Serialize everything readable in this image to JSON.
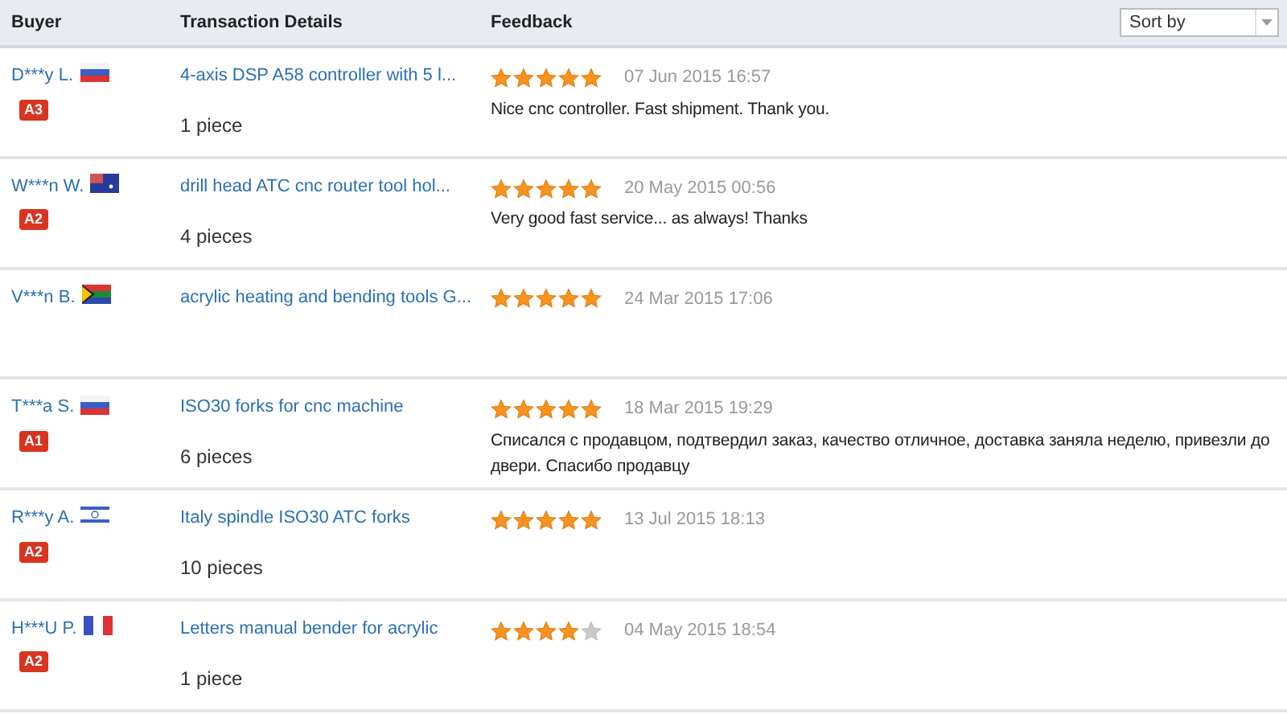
{
  "table": {
    "columns": [
      "Buyer",
      "Transaction Details",
      "Feedback"
    ],
    "sort": {
      "placeholder": "Sort by"
    },
    "rows": [
      {
        "buyer": "D***y L.",
        "flag": {
          "kind": "ru"
        },
        "badge": "A3",
        "product": "4-axis DSP A58 controller with 5 l...",
        "quantity": "1 piece",
        "stars": 5,
        "date": "07 Jun 2015 16:57",
        "comment": "Nice cnc controller. Fast shipment. Thank you."
      },
      {
        "buyer": "W***n W.",
        "flag": {
          "kind": "au"
        },
        "badge": "A2",
        "product": "drill head ATC cnc router tool hol...",
        "quantity": "4 pieces",
        "stars": 5,
        "date": "20 May 2015 00:56",
        "comment": "Very good fast service... as always! Thanks"
      },
      {
        "buyer": "V***n B.",
        "flag": {
          "kind": "za"
        },
        "product": "acrylic heating and bending tools G...",
        "stars": 5,
        "date": "24 Mar 2015 17:06"
      },
      {
        "buyer": "T***a S.",
        "flag": {
          "kind": "ru"
        },
        "badge": "A1",
        "product": "ISO30 forks for cnc machine",
        "quantity": "6 pieces",
        "stars": 5,
        "date": "18 Mar 2015 19:29",
        "comment": "Списался с продавцом, подтвердил заказ, качество отличное, доставка заняла неделю, привезли до двери. Спасибо продавцу"
      },
      {
        "buyer": "R***y A.",
        "flag": {
          "kind": "il"
        },
        "badge": "A2",
        "product": "Italy spindle ISO30 ATC forks",
        "quantity": "10 pieces",
        "stars": 5,
        "date": "13 Jul 2015 18:13"
      },
      {
        "buyer": "H***U P.",
        "flag": {
          "kind": "fr"
        },
        "badge": "A2",
        "product": "Letters manual bender for acrylic",
        "quantity": "1 piece",
        "stars": 4,
        "date": "04 May 2015 18:54"
      }
    ]
  }
}
